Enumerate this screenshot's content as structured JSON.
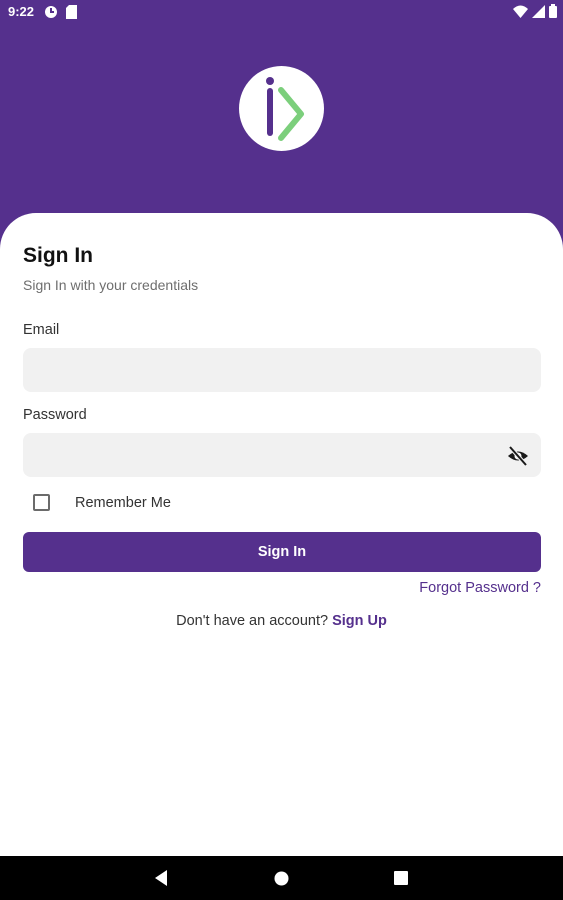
{
  "status_bar": {
    "time": "9:22",
    "left_icons": [
      "sync-icon",
      "sim-card-icon"
    ],
    "right_icons": [
      "wifi-icon",
      "signal-icon",
      "battery-icon"
    ]
  },
  "header": {
    "background_color": "#55308d",
    "logo_icon": "id-logo-icon"
  },
  "sign_in": {
    "title": "Sign In",
    "subtitle": "Sign In with your credentials",
    "email_label": "Email",
    "email_value": "",
    "password_label": "Password",
    "password_value": "",
    "password_toggle_icon": "eye-off-icon",
    "remember_me_label": "Remember Me",
    "remember_me_checked": false,
    "button_label": "Sign In",
    "forgot_password": "Forgot Password ?",
    "no_account_text": "Don't have an account?",
    "sign_up_link": "Sign Up"
  },
  "colors": {
    "primary": "#55308d",
    "logo_accent": "#7ccf7c",
    "input_background": "#f1f1f1"
  },
  "nav_bar": {
    "buttons": [
      "back-icon",
      "home-icon",
      "recents-icon"
    ]
  }
}
